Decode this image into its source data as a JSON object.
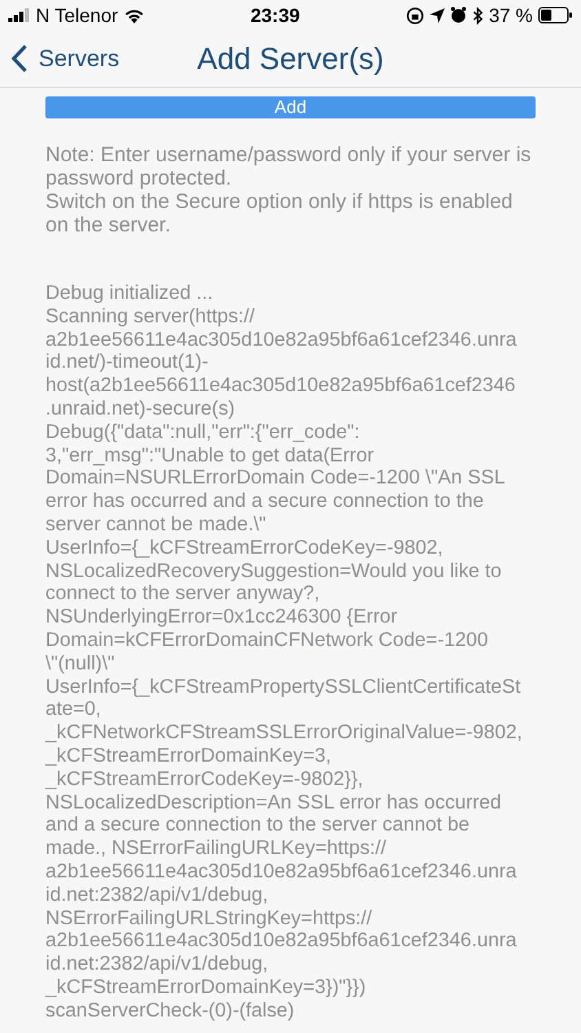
{
  "status_bar": {
    "carrier": "N Telenor",
    "time": "23:39",
    "battery": "37 %"
  },
  "nav": {
    "back": "Servers",
    "title": "Add Server(s)"
  },
  "add_button": "Add",
  "notes": [
    "Note: Enter username/password only if your server is password protected.",
    "Switch on the Secure option only if https is enabled on the server."
  ],
  "debug_log": [
    "Debug initialized ...",
    "Scanning server(https://",
    "a2b1ee56611e4ac305d10e82a95bf6a61cef2346.unra",
    "id.net/)-timeout(1)-",
    "host(a2b1ee56611e4ac305d10e82a95bf6a61cef2346",
    ".unraid.net)-secure(s)",
    "Debug({\"data\":null,\"err\":{\"err_code\":",
    "3,\"err_msg\":\"Unable to get data(Error",
    "Domain=NSURLErrorDomain Code=-1200 \\\"An SSL",
    "error has occurred and a secure connection to the",
    "server cannot be made.\\\"",
    "UserInfo={_kCFStreamErrorCodeKey=-9802,",
    "NSLocalizedRecoverySuggestion=Would you like to",
    "connect to the server anyway?,",
    "NSUnderlyingError=0x1cc246300 {Error",
    "Domain=kCFErrorDomainCFNetwork Code=-1200",
    "\\\"(null)\\\"",
    "UserInfo={_kCFStreamPropertySSLClientCertificateSt",
    "ate=0,",
    "_kCFNetworkCFStreamSSLErrorOriginalValue=-9802,",
    "_kCFStreamErrorDomainKey=3,",
    "_kCFStreamErrorCodeKey=-9802}},",
    "NSLocalizedDescription=An SSL error has occurred",
    "and a secure connection to the server cannot be",
    "made., NSErrorFailingURLKey=https://",
    "a2b1ee56611e4ac305d10e82a95bf6a61cef2346.unra",
    "id.net:2382/api/v1/debug,",
    "NSErrorFailingURLStringKey=https://",
    "a2b1ee56611e4ac305d10e82a95bf6a61cef2346.unra",
    "id.net:2382/api/v1/debug,",
    "_kCFStreamErrorDomainKey=3})\"}})",
    "scanServerCheck-(0)-(false)"
  ]
}
